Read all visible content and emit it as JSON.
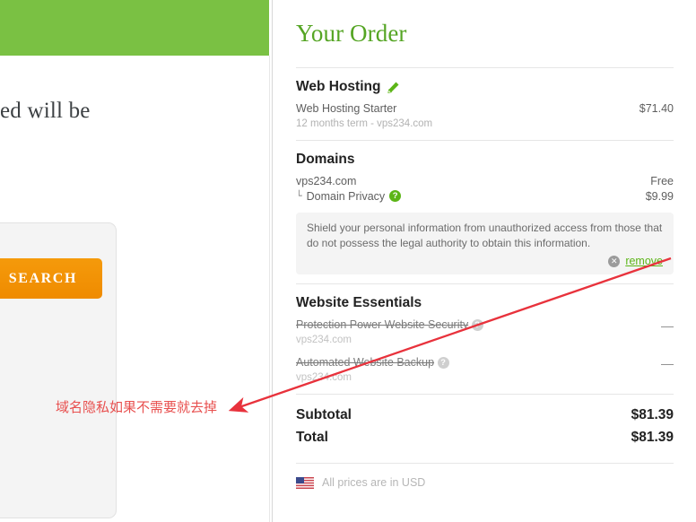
{
  "left_panel": {
    "banner_color": "#7ac143",
    "partial_text": "ed will be",
    "search_button_label": "SEARCH",
    "annotation": "域名隐私如果不需要就去掉",
    "annotation_color": "#e8504f"
  },
  "order": {
    "title": "Your Order",
    "sections": [
      {
        "name": "web-hosting",
        "title": "Web Hosting",
        "edit_icon": "pencil-icon",
        "items": [
          {
            "label": "Web Hosting Starter",
            "sub": "12 months term - vps234.com",
            "price": "$71.40"
          }
        ]
      },
      {
        "name": "domains",
        "title": "Domains",
        "items": [
          {
            "label": "vps234.com",
            "price": "Free"
          },
          {
            "label": "Domain Privacy",
            "tree_glyph": "└",
            "help_icon": "help-icon",
            "price": "$9.99"
          }
        ],
        "info_box": {
          "text": "Shield your personal information from unauthorized access from those that do not possess the legal authority to obtain this information.",
          "remove_icon": "close-circle-icon",
          "remove_label": "remove"
        }
      },
      {
        "name": "website-essentials",
        "title": "Website Essentials",
        "items": [
          {
            "label": "Protection Power Website Security",
            "sub": "vps234.com",
            "help_icon": "help-icon-gray",
            "price": "—",
            "disabled": true
          },
          {
            "label": "Automated Website Backup",
            "sub": "vps234.com",
            "help_icon": "help-icon-gray",
            "price": "—",
            "disabled": true
          }
        ]
      }
    ],
    "totals": [
      {
        "label": "Subtotal",
        "value": "$81.39"
      },
      {
        "label": "Total",
        "value": "$81.39"
      }
    ],
    "currency": {
      "flag": "us-flag-icon",
      "note": "All prices are in USD"
    },
    "accent_green": "#5cb517",
    "title_green": "#55a524"
  }
}
